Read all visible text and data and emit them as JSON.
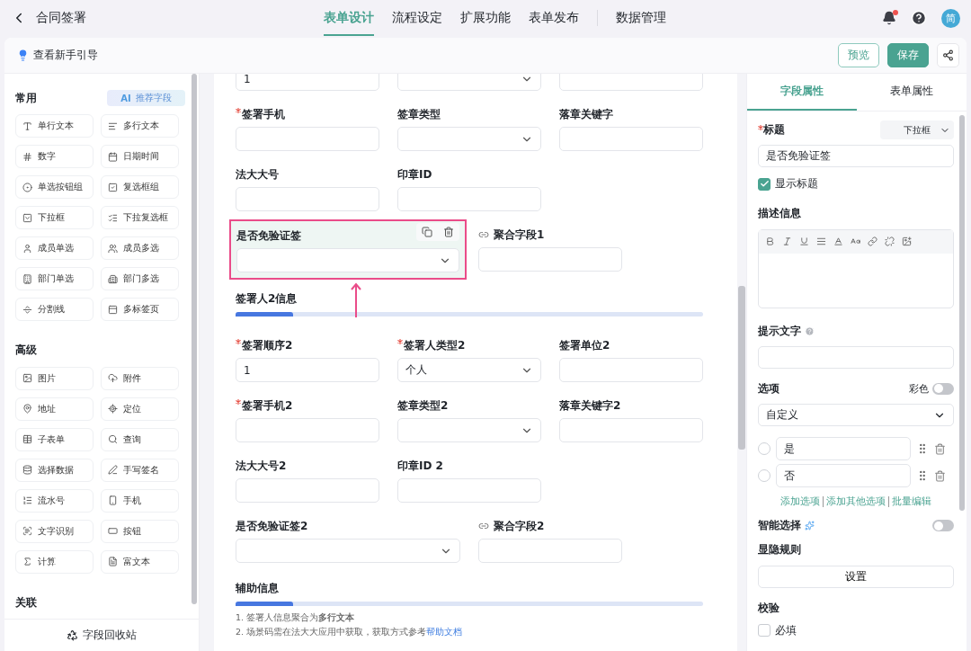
{
  "header": {
    "title": "合同签署",
    "nav": [
      {
        "label": "表单设计",
        "selected": true
      },
      {
        "label": "流程设定",
        "selected": false
      },
      {
        "label": "扩展功能",
        "selected": false
      },
      {
        "label": "表单发布",
        "selected": false
      },
      {
        "label": "数据管理",
        "selected": false
      }
    ],
    "notification_unread": true,
    "avatar": "简"
  },
  "toolbar": {
    "guide": "查看新手引导",
    "buttons": [
      {
        "kind": "outline",
        "label": "预览"
      },
      {
        "kind": "primary",
        "label": "保存"
      },
      {
        "kind": "share"
      }
    ]
  },
  "palette": {
    "sections": [
      {
        "title": "常用",
        "recommend": {
          "ai": "AI",
          "label": "推荐字段"
        },
        "items": [
          "单行文本",
          "多行文本",
          "数字",
          "日期时间",
          "单选按钮组",
          "复选框组",
          "下拉框",
          "下拉复选框",
          "成员单选",
          "成员多选",
          "部门单选",
          "部门多选",
          "分割线",
          "多标签页"
        ]
      },
      {
        "title": "高级",
        "items": [
          "图片",
          "附件",
          "地址",
          "定位",
          "子表单",
          "查询",
          "选择数据",
          "手写签名",
          "流水号",
          "手机",
          "文字识别",
          "按钮",
          "计算",
          "富文本"
        ]
      },
      {
        "title": "关联"
      }
    ],
    "recycle": "字段回收站"
  },
  "form": {
    "blocks": [
      {
        "kind": "row",
        "fields": [
          {
            "kind": "input",
            "value": "1",
            "selected": false
          },
          {
            "kind": "select",
            "selected": false
          },
          {
            "kind": "input",
            "selected": false
          }
        ]
      },
      {
        "kind": "row",
        "fields": [
          {
            "kind": "input",
            "label": "签署手机",
            "required": true,
            "selected": false
          },
          {
            "kind": "select",
            "label": "签章类型",
            "selected": false
          },
          {
            "kind": "input",
            "label": "落章关键字",
            "selected": false
          }
        ]
      },
      {
        "kind": "row",
        "fields": [
          {
            "kind": "input",
            "label": "法大大号",
            "selected": false
          },
          {
            "kind": "input",
            "label": "印章ID",
            "selected": false
          }
        ]
      },
      {
        "kind": "row",
        "fields": [
          {
            "kind": "select",
            "label": "是否免验证签",
            "wide": true,
            "selected": true
          },
          {
            "kind": "input",
            "label": "聚合字段1",
            "linked": true,
            "selected": false
          }
        ]
      },
      {
        "kind": "section",
        "title": "签署人2信息"
      },
      {
        "kind": "row",
        "fields": [
          {
            "kind": "input",
            "label": "签署顺序2",
            "required": true,
            "value": "1",
            "selected": false
          },
          {
            "kind": "select",
            "label": "签署人类型2",
            "required": true,
            "value": "个人",
            "selected": false
          },
          {
            "kind": "input",
            "label": "签署单位2",
            "selected": false
          }
        ]
      },
      {
        "kind": "row",
        "fields": [
          {
            "kind": "input",
            "label": "签署手机2",
            "required": true,
            "selected": false
          },
          {
            "kind": "select",
            "label": "签章类型2",
            "selected": false
          },
          {
            "kind": "input",
            "label": "落章关键字2",
            "selected": false
          }
        ]
      },
      {
        "kind": "row",
        "fields": [
          {
            "kind": "input",
            "label": "法大大号2",
            "selected": false
          },
          {
            "kind": "input",
            "label": "印章ID 2",
            "selected": false
          }
        ]
      },
      {
        "kind": "row",
        "fields": [
          {
            "kind": "select",
            "label": "是否免验证签2",
            "wide": true,
            "selected": false
          },
          {
            "kind": "input",
            "label": "聚合字段2",
            "linked": true,
            "selected": false
          }
        ]
      },
      {
        "kind": "section",
        "title": "辅助信息",
        "notes": [
          {
            "text": "1. 签署人信息聚合为**多行文本**"
          },
          {
            "text": "2. 场景码需在法大大应用中获取，获取方式参考",
            "link": "帮助文档"
          }
        ]
      }
    ]
  },
  "properties": {
    "tabs": [
      {
        "label": "字段属性",
        "selected": true
      },
      {
        "label": "表单属性",
        "selected": false
      }
    ],
    "title": {
      "label": "标题",
      "required": true,
      "type": "下拉框",
      "value": "是否免验证签"
    },
    "show_title": {
      "label": "显示标题",
      "checked": true
    },
    "description": {
      "label": "描述信息"
    },
    "hint": {
      "label": "提示文字"
    },
    "options": {
      "label": "选项",
      "color_toggle": {
        "label": "彩色",
        "on": false
      },
      "source": "自定义",
      "items": [
        {
          "label": "是",
          "selected": false
        },
        {
          "label": "否",
          "selected": false
        }
      ],
      "links": [
        "添加选项",
        "添加其他选项",
        "批量编辑"
      ]
    },
    "smart_select": {
      "label": "智能选择",
      "on": false
    },
    "visibility": {
      "label": "显隐规则",
      "button": "设置"
    },
    "validation": {
      "label": "校验",
      "rules": [
        {
          "label": "必填",
          "checked": false
        }
      ]
    }
  }
}
